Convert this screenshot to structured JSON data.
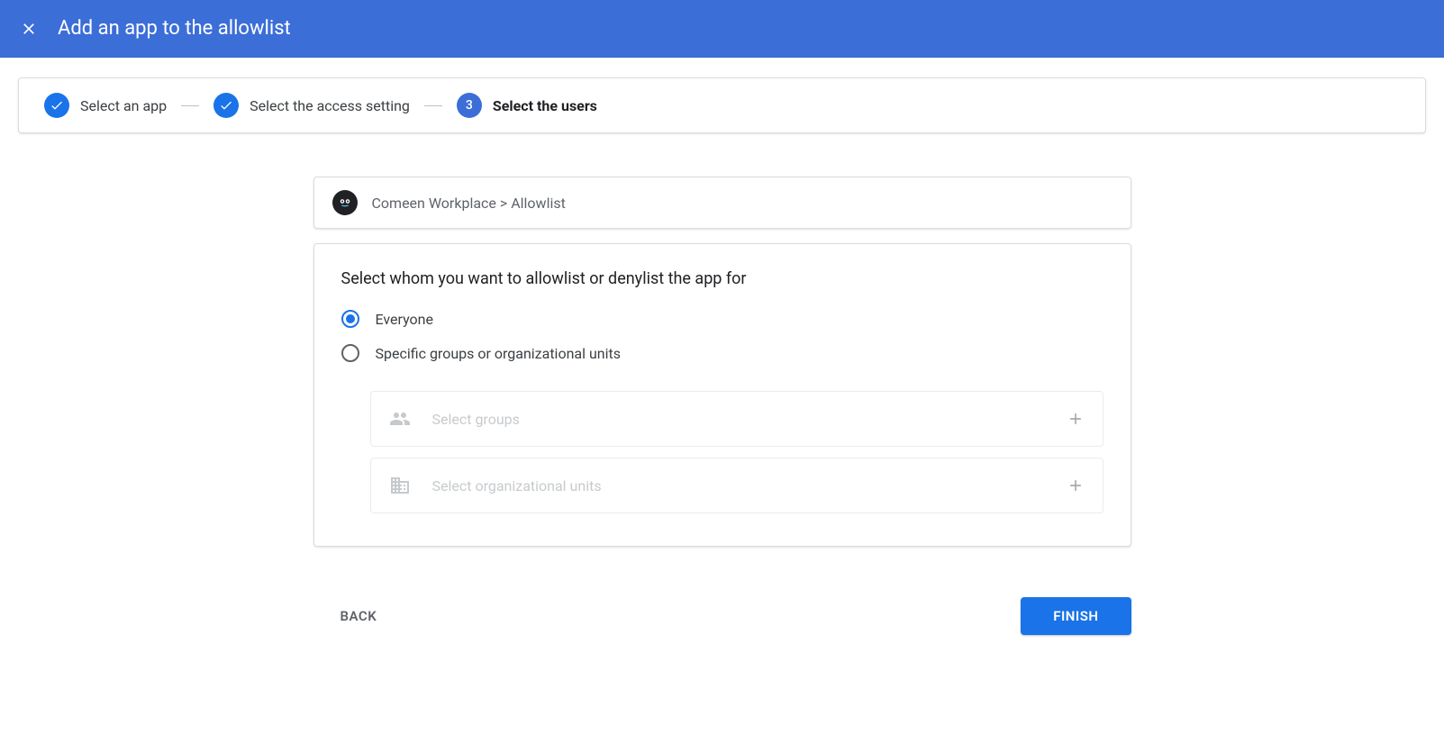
{
  "header": {
    "title": "Add an app to the allowlist"
  },
  "stepper": {
    "steps": [
      {
        "label": "Select an app",
        "completed": true
      },
      {
        "label": "Select the access setting",
        "completed": true
      },
      {
        "label": "Select the users",
        "number": "3",
        "active": true
      }
    ]
  },
  "breadcrumb": {
    "app_name": "Comeen Workplace",
    "separator": " > ",
    "page": "Allowlist"
  },
  "main": {
    "heading": "Select whom you want to allowlist or denylist the app for",
    "options": {
      "everyone": "Everyone",
      "specific": "Specific groups or organizational units"
    },
    "selectors": {
      "groups": "Select groups",
      "org_units": "Select organizational units"
    }
  },
  "footer": {
    "back_label": "BACK",
    "finish_label": "FINISH"
  }
}
